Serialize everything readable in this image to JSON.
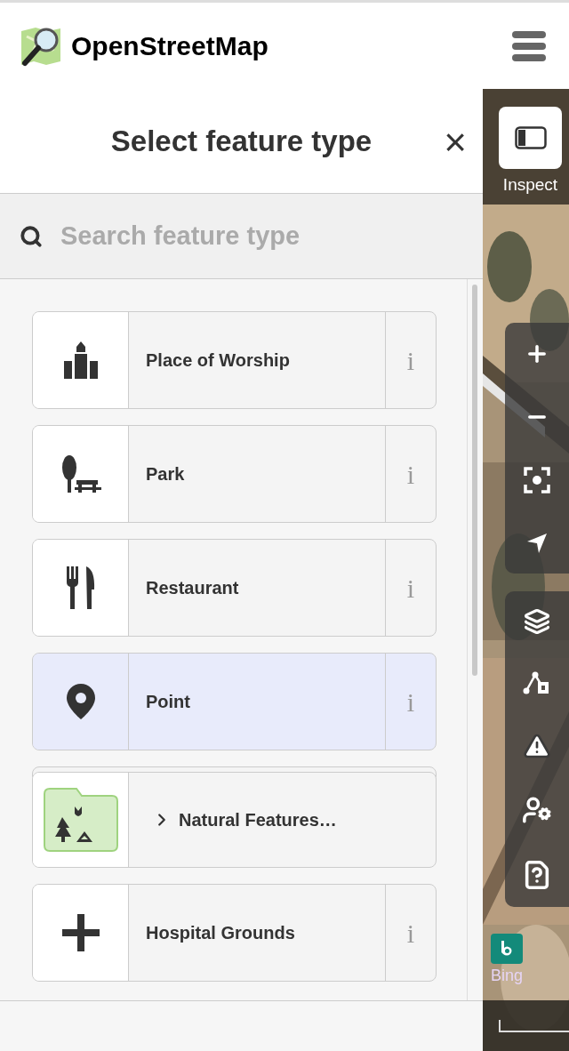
{
  "header": {
    "brand": "OpenStreetMap"
  },
  "panel": {
    "title": "Select feature type",
    "close": "×",
    "search": {
      "placeholder": "Search feature type"
    }
  },
  "presets": [
    {
      "kind": "preset",
      "label": "Place of Worship",
      "info": "i",
      "selected": false
    },
    {
      "kind": "preset",
      "label": "Park",
      "info": "i",
      "selected": false
    },
    {
      "kind": "preset",
      "label": "Restaurant",
      "info": "i",
      "selected": false
    },
    {
      "kind": "preset",
      "label": "Point",
      "info": "i",
      "selected": true
    },
    {
      "kind": "category",
      "label": "Natural Features…",
      "selected": false
    },
    {
      "kind": "preset",
      "label": "Hospital Grounds",
      "info": "i",
      "selected": false
    }
  ],
  "map": {
    "inspect": "Inspect",
    "imagery": "Bing"
  }
}
